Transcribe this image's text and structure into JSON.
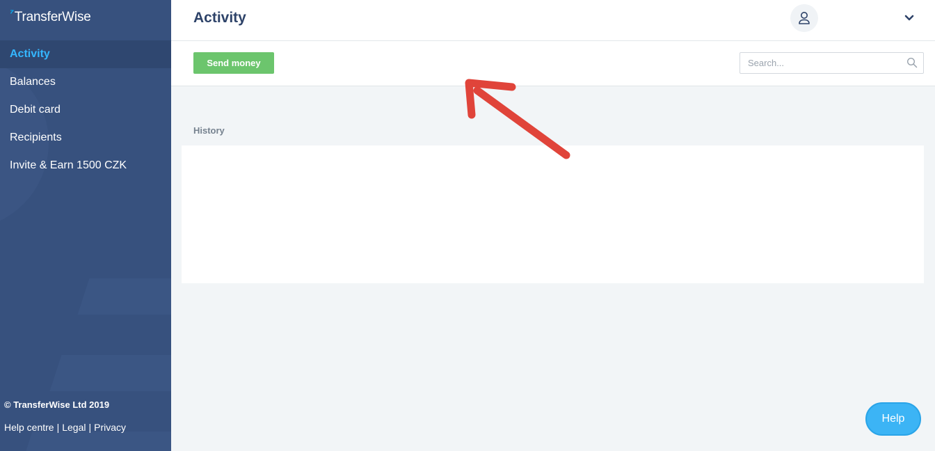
{
  "brand": {
    "logo_mark": "⁷",
    "name": "TransferWise"
  },
  "sidebar": {
    "items": [
      {
        "label": "Activity",
        "active": true
      },
      {
        "label": "Balances",
        "active": false
      },
      {
        "label": "Debit card",
        "active": false
      },
      {
        "label": "Recipients",
        "active": false
      },
      {
        "label": "Invite & Earn 1500 CZK",
        "active": false
      }
    ],
    "footer": {
      "copyright": "© TransferWise Ltd 2019",
      "links": [
        "Help centre",
        "Legal",
        "Privacy"
      ],
      "separator": "|"
    }
  },
  "header": {
    "title": "Activity",
    "avatar_icon": "user-icon",
    "menu_icon": "chevron-down-icon"
  },
  "toolbar": {
    "send_label": "Send money",
    "search_placeholder": "Search...",
    "search_icon": "search-icon"
  },
  "history": {
    "label": "History"
  },
  "help": {
    "label": "Help"
  },
  "colors": {
    "sidebar_bg": "#37517e",
    "accent": "#34b7ff",
    "send_button": "#6cc56d",
    "annotation_arrow": "#e0443a"
  }
}
